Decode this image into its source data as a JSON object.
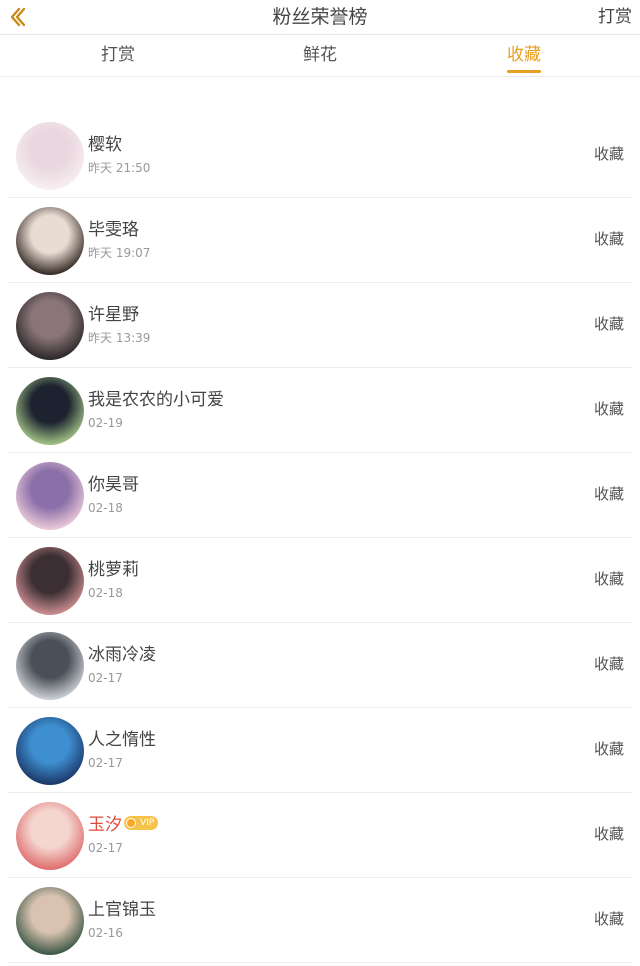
{
  "header": {
    "title": "粉丝荣誉榜",
    "back_icon": "chevron-left-icon",
    "action_label": "打赏"
  },
  "tabs": [
    {
      "label": "打赏",
      "active": false
    },
    {
      "label": "鲜花",
      "active": false
    },
    {
      "label": "收藏",
      "active": true
    }
  ],
  "colors": {
    "accent": "#e8a020",
    "vip_name": "#e04a3a"
  },
  "rows": [
    {
      "name": "樱软",
      "time": "昨天 21:50",
      "action": "收藏",
      "vip": false,
      "avatar": [
        "#f7eef2",
        "#e9d6de"
      ]
    },
    {
      "name": "毕雯珞",
      "time": "昨天 19:07",
      "action": "收藏",
      "vip": false,
      "avatar": [
        "#3a2e2a",
        "#e9dcd3"
      ]
    },
    {
      "name": "许星野",
      "time": "昨天 13:39",
      "action": "收藏",
      "vip": false,
      "avatar": [
        "#2f2a2c",
        "#8a7578"
      ]
    },
    {
      "name": "我是农农的小可爱",
      "time": "02-19",
      "action": "收藏",
      "vip": false,
      "avatar": [
        "#9fbf84",
        "#1c2230"
      ]
    },
    {
      "name": "你昊哥",
      "time": "02-18",
      "action": "收藏",
      "vip": false,
      "avatar": [
        "#e9c8d8",
        "#8a6fa8"
      ]
    },
    {
      "name": "桃萝莉",
      "time": "02-18",
      "action": "收藏",
      "vip": false,
      "avatar": [
        "#c98b90",
        "#3b2f33"
      ]
    },
    {
      "name": "冰雨冷凌",
      "time": "02-17",
      "action": "收藏",
      "vip": false,
      "avatar": [
        "#c9cdd3",
        "#4b4f57"
      ]
    },
    {
      "name": "人之惰性",
      "time": "02-17",
      "action": "收藏",
      "vip": false,
      "avatar": [
        "#1d3a6b",
        "#3e8fd0"
      ]
    },
    {
      "name": "玉汐",
      "time": "02-17",
      "action": "收藏",
      "vip": true,
      "vip_label": "VIP",
      "avatar": [
        "#e07070",
        "#f4d6cf"
      ]
    },
    {
      "name": "上官锦玉",
      "time": "02-16",
      "action": "收藏",
      "vip": false,
      "avatar": [
        "#3f5a48",
        "#d9c2b0"
      ]
    }
  ]
}
